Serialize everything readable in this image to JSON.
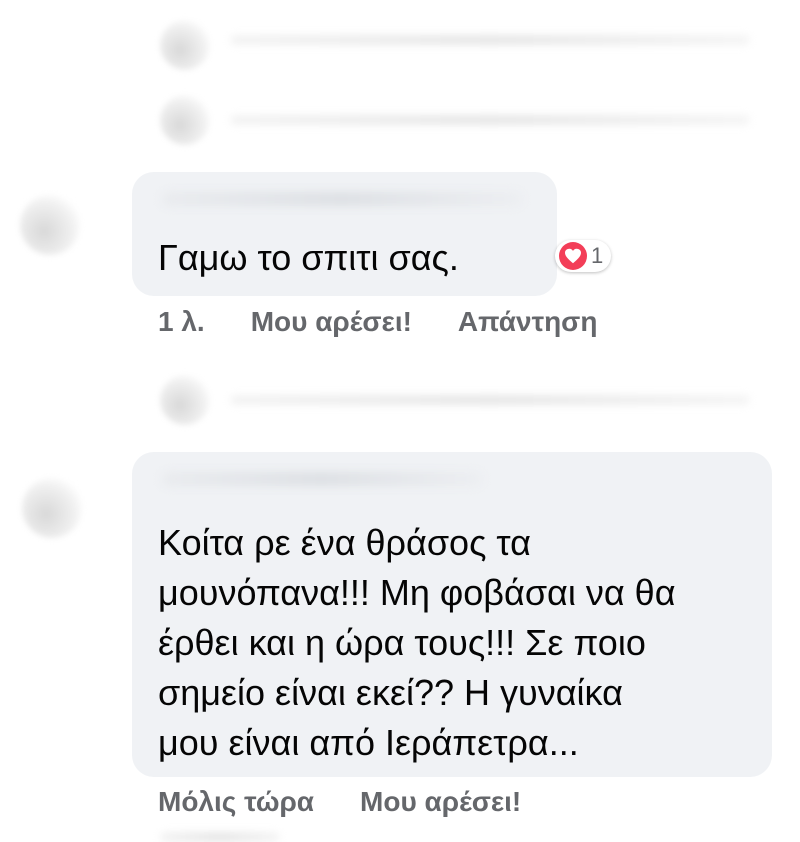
{
  "comments": [
    {
      "text": "Γαμω το σπιτι σας.",
      "reaction": {
        "icon": "heart-icon",
        "count": "1",
        "color": "#f33e58"
      },
      "meta": {
        "time": "1 λ.",
        "like": "Μου αρέσει!",
        "reply": "Απάντηση"
      }
    },
    {
      "text": "Κοίτα ρε ένα θράσος τα\nμουνόπανα!!! Μη φοβάσαι να θα\nέρθει και η ώρα τους!!! Σε ποιο\nσημείο είναι εκεί?? Η γυναίκα\nμου είναι από Ιεράπετρα...",
      "meta": {
        "time": "Μόλις τώρα",
        "like": "Μου αρέσει!"
      }
    }
  ],
  "colors": {
    "bubble": "#f0f2f5",
    "meta_text": "#65676b",
    "text": "#050505"
  }
}
